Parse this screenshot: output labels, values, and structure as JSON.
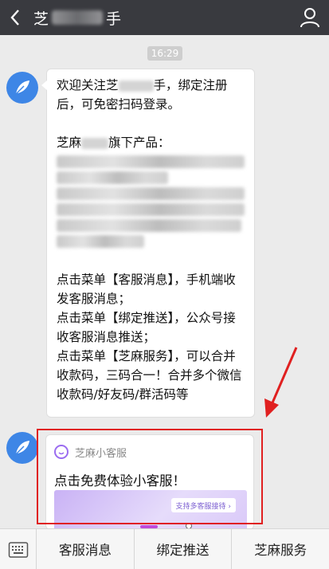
{
  "header": {
    "title_prefix": "芝",
    "title_suffix": "手"
  },
  "chat": {
    "time": "16:29",
    "message": {
      "welcome_a": "欢迎关注芝",
      "welcome_b": "手，绑定注册",
      "welcome_c": "后，可免密扫码登录。",
      "product_a": "芝麻",
      "product_b": "旗下产品：",
      "menu1": "点击菜单【客服消息】，手机端收发客服消息；",
      "menu2": "点击菜单【绑定推送】，公众号接收客服消息推送；",
      "menu3": "点击菜单【芝麻服务】，可以合并收款码，三码合一！合并多个微信收款码/好友码/群活码等"
    },
    "card": {
      "source": "芝麻小客服",
      "title": "点击免费体验小客服！"
    }
  },
  "bottom_menu": {
    "items": [
      "客服消息",
      "绑定推送",
      "芝麻服务"
    ]
  },
  "colors": {
    "header_bg": "#393a3f",
    "accent_blue": "#3e86e6",
    "highlight_red": "#e02020"
  }
}
